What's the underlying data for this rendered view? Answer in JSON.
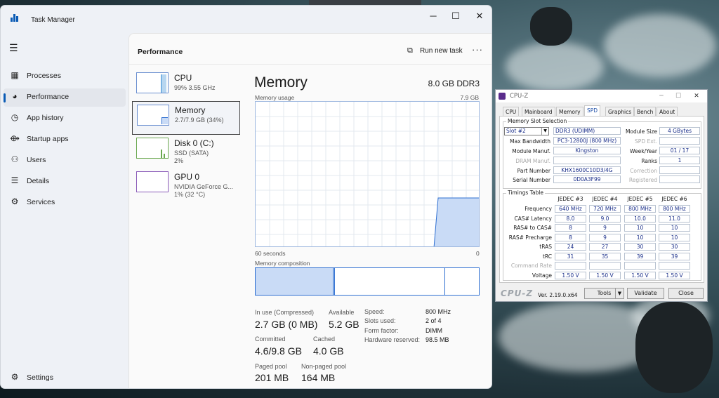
{
  "taskmanager": {
    "title": "Task Manager",
    "page_title": "Performance",
    "run_new_task": "Run new task",
    "nav": [
      {
        "label": "Processes",
        "icon": "processes-icon",
        "glyph": "▦"
      },
      {
        "label": "Performance",
        "icon": "performance-icon",
        "glyph": "◕"
      },
      {
        "label": "App history",
        "icon": "app-history-icon",
        "glyph": "◷"
      },
      {
        "label": "Startup apps",
        "icon": "startup-apps-icon",
        "glyph": "⟴"
      },
      {
        "label": "Users",
        "icon": "users-icon",
        "glyph": "⚇"
      },
      {
        "label": "Details",
        "icon": "details-icon",
        "glyph": "☰"
      },
      {
        "label": "Services",
        "icon": "services-icon",
        "glyph": "⚙"
      }
    ],
    "settings": "Settings",
    "resources": [
      {
        "name": "CPU",
        "sub1": "99% 3.55 GHz",
        "sub2": ""
      },
      {
        "name": "Memory",
        "sub1": "2.7/7.9 GB (34%)",
        "sub2": ""
      },
      {
        "name": "Disk 0 (C:)",
        "sub1": "SSD (SATA)",
        "sub2": "2%"
      },
      {
        "name": "GPU 0",
        "sub1": "NVIDIA GeForce G...",
        "sub2": "1% (32 °C)"
      }
    ],
    "memory": {
      "title": "Memory",
      "spec": "8.0 GB DDR3",
      "usage_label": "Memory usage",
      "max_label": "7.9 GB",
      "seconds_label": "60 seconds",
      "zero_label": "0",
      "composition_label": "Memory composition",
      "stats": {
        "inuse_label": "In use (Compressed)",
        "inuse_value": "2.7 GB (0 MB)",
        "available_label": "Available",
        "available_value": "5.2 GB",
        "committed_label": "Committed",
        "committed_value": "4.6/9.8 GB",
        "cached_label": "Cached",
        "cached_value": "4.0 GB",
        "paged_label": "Paged pool",
        "paged_value": "201 MB",
        "nonpaged_label": "Non-paged pool",
        "nonpaged_value": "164 MB"
      },
      "props": [
        {
          "k": "Speed:",
          "v": "800 MHz"
        },
        {
          "k": "Slots used:",
          "v": "2 of 4"
        },
        {
          "k": "Form factor:",
          "v": "DIMM"
        },
        {
          "k": "Hardware reserved:",
          "v": "98.5 MB"
        }
      ]
    }
  },
  "cpuz": {
    "title": "CPU-Z",
    "tabs": [
      "CPU",
      "Mainboard",
      "Memory",
      "SPD",
      "Graphics",
      "Bench",
      "About"
    ],
    "active_tab": "SPD",
    "slot_group_label": "Memory Slot Selection",
    "slot_value": "Slot #2",
    "module_type": "DDR3 (UDIMM)",
    "module_size_label": "Module Size",
    "module_size": "4 GBytes",
    "max_bandwidth_label": "Max Bandwidth",
    "max_bandwidth": "PC3-12800J (800 MHz)",
    "spd_ext_label": "SPD Ext.",
    "module_manuf_label": "Module Manuf.",
    "module_manuf": "Kingston",
    "week_year_label": "Week/Year",
    "week_year": "01 / 17",
    "dram_manuf_label": "DRAM Manuf.",
    "ranks_label": "Ranks",
    "ranks": "1",
    "part_number_label": "Part Number",
    "part_number": "KHX1600C10D3/4G",
    "correction_label": "Correction",
    "serial_number_label": "Serial Number",
    "serial_number": "0D0A3F99",
    "registered_label": "Registered",
    "timings_label": "Timings Table",
    "timing_cols": [
      "JEDEC #3",
      "JEDEC #4",
      "JEDEC #5",
      "JEDEC #6"
    ],
    "timing_rows": [
      {
        "label": "Frequency",
        "values": [
          "640 MHz",
          "720 MHz",
          "800 MHz",
          "800 MHz"
        ],
        "dim": false
      },
      {
        "label": "CAS# Latency",
        "values": [
          "8.0",
          "9.0",
          "10.0",
          "11.0"
        ],
        "dim": false
      },
      {
        "label": "RAS# to CAS#",
        "values": [
          "8",
          "9",
          "10",
          "10"
        ],
        "dim": false
      },
      {
        "label": "RAS# Precharge",
        "values": [
          "8",
          "9",
          "10",
          "10"
        ],
        "dim": false
      },
      {
        "label": "tRAS",
        "values": [
          "24",
          "27",
          "30",
          "30"
        ],
        "dim": false
      },
      {
        "label": "tRC",
        "values": [
          "31",
          "35",
          "39",
          "39"
        ],
        "dim": false
      },
      {
        "label": "Command Rate",
        "values": [
          "",
          "",
          "",
          ""
        ],
        "dim": true
      },
      {
        "label": "Voltage",
        "values": [
          "1.50 V",
          "1.50 V",
          "1.50 V",
          "1.50 V"
        ],
        "dim": false
      }
    ],
    "logo": "CPU-Z",
    "version": "Ver. 2.19.0.x64",
    "tools_label": "Tools",
    "validate_label": "Validate",
    "close_label": "Close"
  }
}
